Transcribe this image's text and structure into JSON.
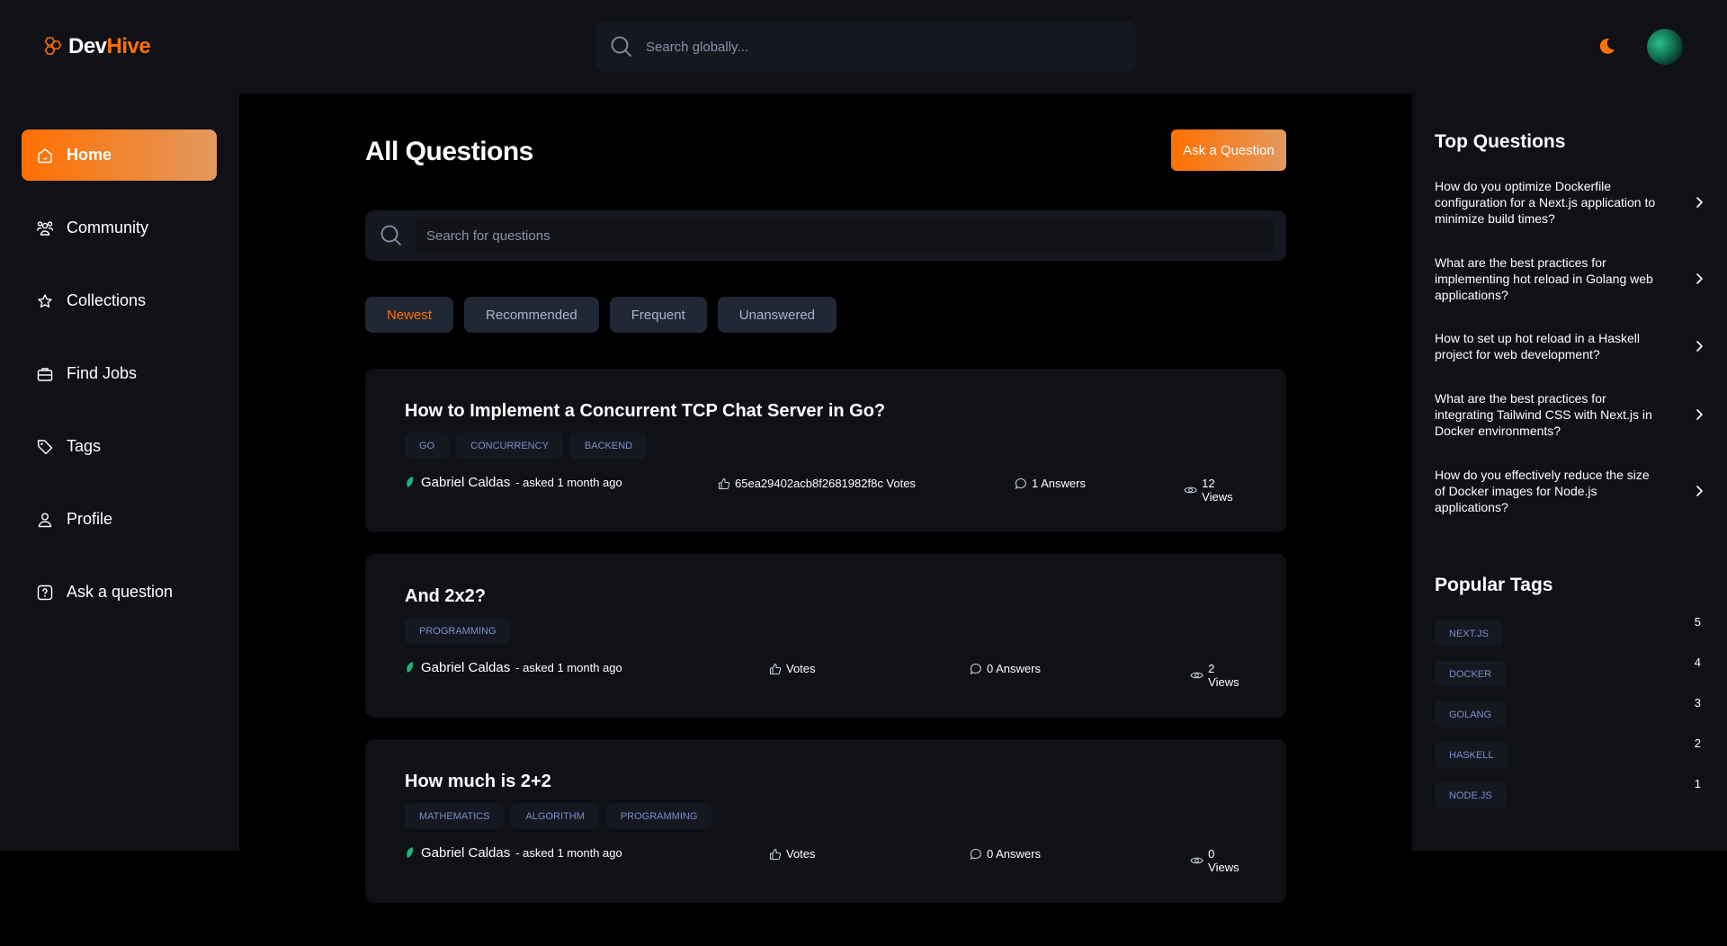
{
  "app": {
    "logo_dev": "Dev",
    "logo_hive": "Hive",
    "global_search_placeholder": "Search globally..."
  },
  "sidebar": {
    "items": [
      {
        "label": "Home",
        "icon": "home-icon",
        "active": true
      },
      {
        "label": "Community",
        "icon": "users-icon",
        "active": false
      },
      {
        "label": "Collections",
        "icon": "star-icon",
        "active": false
      },
      {
        "label": "Find Jobs",
        "icon": "briefcase-icon",
        "active": false
      },
      {
        "label": "Tags",
        "icon": "tag-icon",
        "active": false
      },
      {
        "label": "Profile",
        "icon": "user-icon",
        "active": false
      },
      {
        "label": "Ask a question",
        "icon": "question-icon",
        "active": false
      }
    ]
  },
  "main": {
    "title": "All Questions",
    "ask_button": "Ask a Question",
    "search_placeholder": "Search for questions",
    "filters": [
      {
        "label": "Newest",
        "active": true
      },
      {
        "label": "Recommended",
        "active": false
      },
      {
        "label": "Frequent",
        "active": false
      },
      {
        "label": "Unanswered",
        "active": false
      }
    ],
    "questions": [
      {
        "title": "How to Implement a Concurrent TCP Chat Server in Go?",
        "tags": [
          "GO",
          "CONCURRENCY",
          "BACKEND"
        ],
        "author": "Gabriel Caldas",
        "asked": " - asked 1 month ago",
        "votes": "65ea29402acb8f2681982f8c Votes",
        "answers": "1 Answers",
        "views": "12 Views"
      },
      {
        "title": "And 2x2?",
        "tags": [
          "PROGRAMMING"
        ],
        "author": "Gabriel Caldas",
        "asked": " - asked 1 month ago",
        "votes": "Votes",
        "answers": "0 Answers",
        "views": "2 Views"
      },
      {
        "title": "How much is 2+2",
        "tags": [
          "MATHEMATICS",
          "ALGORITHM",
          "PROGRAMMING"
        ],
        "author": "Gabriel Caldas",
        "asked": " - asked 1 month ago",
        "votes": "Votes",
        "answers": "0 Answers",
        "views": "0 Views"
      }
    ]
  },
  "right_sidebar": {
    "top_questions_title": "Top Questions",
    "top_questions": [
      "How do you optimize Dockerfile configuration for a Next.js application to minimize build times?",
      "What are the best practices for implementing hot reload in Golang web applications?",
      "How to set up hot reload in a Haskell project for web development?",
      "What are the best practices for integrating Tailwind CSS with Next.js in Docker environments?",
      "How do you effectively reduce the size of Docker images for Node.js applications?"
    ],
    "popular_tags_title": "Popular Tags",
    "popular_tags": [
      {
        "name": "NEXT.JS",
        "count": "5"
      },
      {
        "name": "DOCKER",
        "count": "4"
      },
      {
        "name": "GOLANG",
        "count": "3"
      },
      {
        "name": "HASKELL",
        "count": "2"
      },
      {
        "name": "NODE.JS",
        "count": "1"
      }
    ]
  },
  "colors": {
    "accent": "#ff7000",
    "accent_end": "#e2995f",
    "panel": "#0f1117",
    "input": "#151821",
    "tag_text": "#7b8ec8"
  }
}
